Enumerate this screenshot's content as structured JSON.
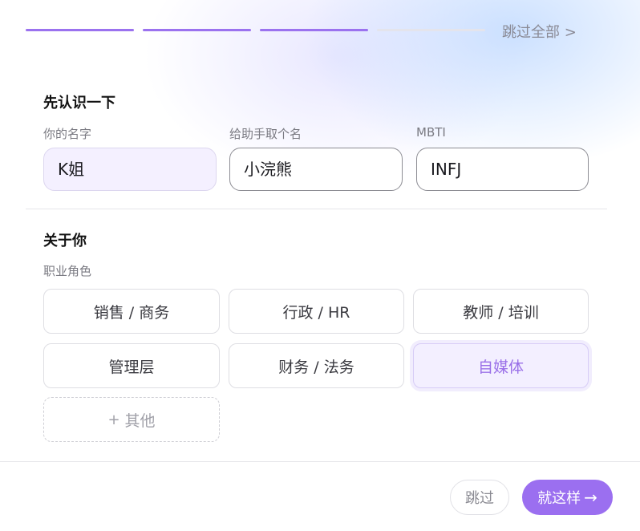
{
  "progress": {
    "total": 4,
    "completed": 3,
    "accent": "#9b72ef"
  },
  "header": {
    "skip_all_label": "跳过全部 >"
  },
  "intro": {
    "title": "先认识一下",
    "name_label": "你的名字",
    "name_value": "K姐",
    "assistant_label": "给助手取个名",
    "assistant_value": "小浣熊",
    "mbti_label": "MBTI",
    "mbti_value": "INFJ"
  },
  "about": {
    "title": "关于你",
    "role_label": "职业角色",
    "roles": [
      "销售 / 商务",
      "行政 / HR",
      "教师 / 培训",
      "管理层",
      "财务 / 法务",
      "自媒体"
    ],
    "selected_role": "自媒体",
    "other_label": "其他",
    "other_icon": "plus-icon"
  },
  "footer": {
    "skip_label": "跳过",
    "confirm_label": "就这样",
    "confirm_icon": "arrow-right-icon"
  }
}
